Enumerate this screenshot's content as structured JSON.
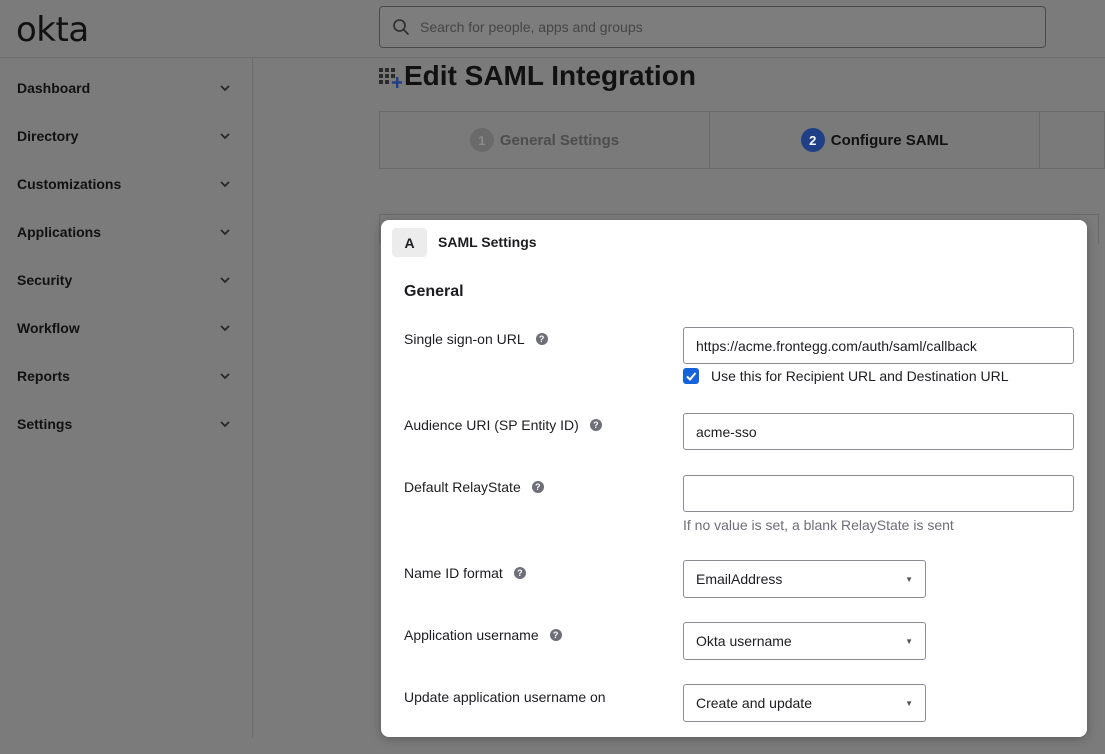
{
  "brand": {
    "logo_text": "okta"
  },
  "search": {
    "placeholder": "Search for people, apps and groups"
  },
  "sidebar": {
    "items": [
      {
        "label": "Dashboard"
      },
      {
        "label": "Directory"
      },
      {
        "label": "Customizations"
      },
      {
        "label": "Applications"
      },
      {
        "label": "Security"
      },
      {
        "label": "Workflow"
      },
      {
        "label": "Reports"
      },
      {
        "label": "Settings"
      }
    ]
  },
  "page": {
    "title": "Edit SAML Integration"
  },
  "stepper": {
    "steps": [
      {
        "number": "1",
        "label": "General Settings",
        "state": "completed"
      },
      {
        "number": "2",
        "label": "Configure SAML",
        "state": "active"
      }
    ]
  },
  "card": {
    "tag": "A",
    "title": "SAML Settings",
    "section": "General",
    "fields": {
      "sso_url": {
        "label": "Single sign-on URL",
        "value": "https://acme.frontegg.com/auth/saml/callback"
      },
      "recipient_checkbox": {
        "label": "Use this for Recipient URL and Destination URL",
        "checked": true
      },
      "audience_uri": {
        "label": "Audience URI (SP Entity ID)",
        "value": "acme-sso"
      },
      "relay_state": {
        "label": "Default RelayState",
        "value": "",
        "hint": "If no value is set, a blank RelayState is sent"
      },
      "name_id_format": {
        "label": "Name ID format",
        "value": "EmailAddress"
      },
      "app_username": {
        "label": "Application username",
        "value": "Okta username"
      },
      "update_username": {
        "label": "Update application username on",
        "value": "Create and update"
      }
    }
  },
  "colors": {
    "accent": "#1662dd",
    "step_active": "#1f3f86"
  }
}
